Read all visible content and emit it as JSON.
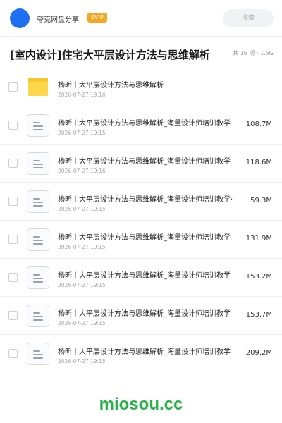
{
  "header": {
    "brand": "夸克网盘分享",
    "badge": "SVIP",
    "search_placeholder": "搜索"
  },
  "share": {
    "title": "[室内设计]住宅大平层设计方法与思维解析",
    "summary": "共 16 项 · 1.5G"
  },
  "files": [
    {
      "type": "folder",
      "name": "杨昕丨大平层设计方法与思维解析",
      "date": "2026-07-27 19:16",
      "size": ""
    },
    {
      "type": "file",
      "name": "杨昕丨大平层设计方法与思维解析_海量设计师培训教学",
      "date": "2026-07-27 19:15",
      "size": "108.7M"
    },
    {
      "type": "file",
      "name": "杨昕丨大平层设计方法与思维解析_海量设计师培训教学",
      "date": "2026-07-27 19:16",
      "size": "118.6M"
    },
    {
      "type": "file",
      "name": "杨昕丨大平层设计方法与思维解析_海量设计师培训教学·",
      "date": "2026-07-27 19:15",
      "size": "59.3M"
    },
    {
      "type": "file",
      "name": "杨昕丨大平层设计方法与思维解析_海量设计师培训教学",
      "date": "2026-07-27 19:15",
      "size": "131.9M"
    },
    {
      "type": "file",
      "name": "杨昕丨大平层设计方法与思维解析_海量设计师培训教学",
      "date": "2026-07-27 19:15",
      "size": "153.2M"
    },
    {
      "type": "file",
      "name": "杨昕丨大平层设计方法与思维解析_海量设计师培训教学",
      "date": "2026-07-27 19:15",
      "size": "153.7M"
    },
    {
      "type": "file",
      "name": "杨昕丨大平层设计方法与思维解析_海量设计师培训教学",
      "date": "2026-07-27 19:15",
      "size": "209.2M"
    }
  ],
  "watermark": "miosou.cc",
  "colors": {
    "accent": "#1f6ff2",
    "badge": "#f5a623",
    "folder": "#ffd54a",
    "watermark": "#2ab24a"
  },
  "icons": {
    "folder": "folder-icon",
    "file": "document-icon",
    "avatar": "avatar"
  }
}
